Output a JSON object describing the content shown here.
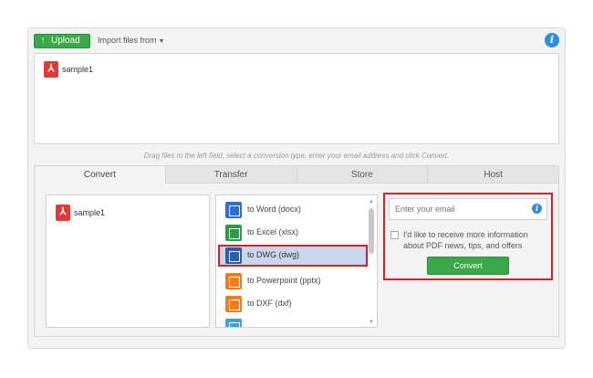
{
  "toolbar": {
    "upload_label": "Upload",
    "import_label": "Import files from",
    "accent_color": "#3aa84a",
    "info_color": "#2b8fe0"
  },
  "dropzone": {
    "files": [
      {
        "name": "sample1",
        "icon": "pdf-icon"
      }
    ],
    "hint": "Drag files to the left field, select a conversion type, enter your email address and click Convert."
  },
  "tabs": [
    {
      "label": "Convert",
      "active": true
    },
    {
      "label": "Transfer",
      "active": false
    },
    {
      "label": "Store",
      "active": false
    },
    {
      "label": "Host",
      "active": false
    }
  ],
  "selected_files": [
    {
      "name": "sample1",
      "icon": "pdf-icon"
    }
  ],
  "conversions": [
    {
      "label": "to Word (docx)",
      "icon": "word-icon",
      "color": "#2b6fd6",
      "selected": false
    },
    {
      "label": "to Excel (xlsx)",
      "icon": "excel-icon",
      "color": "#2e9a4a",
      "selected": false
    },
    {
      "label": "to DWG (dwg)",
      "icon": "dwg-icon",
      "color": "#2a5fb0",
      "selected": true
    },
    {
      "label": "to Powerpoint (pptx)",
      "icon": "powerpoint-icon",
      "color": "#f07c1a",
      "selected": false
    },
    {
      "label": "to DXF (dxf)",
      "icon": "dxf-icon",
      "color": "#f07c1a",
      "selected": false
    }
  ],
  "email": {
    "placeholder": "Enter your email",
    "optin_label": "I'd like to receive more information about PDF news, tips, and offers",
    "convert_label": "Convert"
  },
  "highlight_color": "#e01b24"
}
